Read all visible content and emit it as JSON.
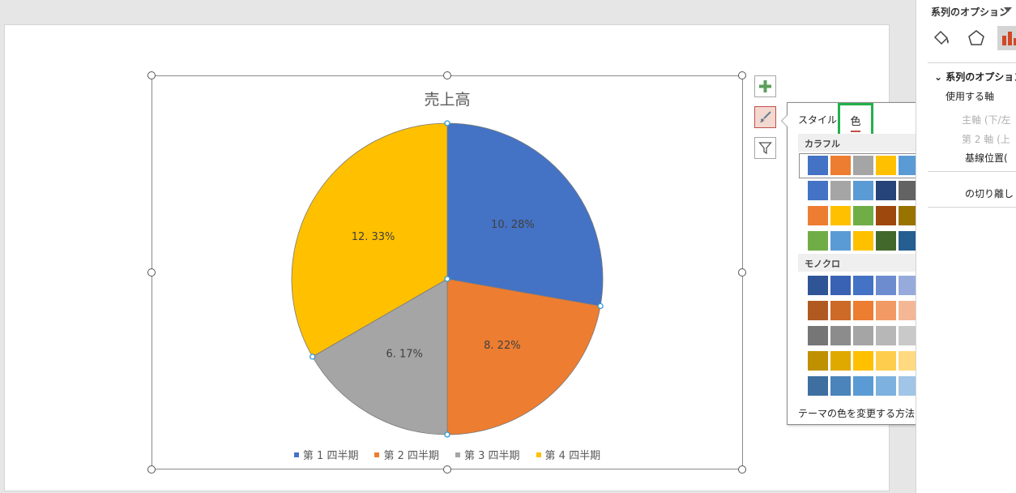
{
  "chart_data": {
    "type": "pie",
    "title": "売上高",
    "categories": [
      "第 1 四半期",
      "第 2 四半期",
      "第 3 四半期",
      "第 4 四半期"
    ],
    "values": [
      10.28,
      8.22,
      6.17,
      12.33
    ],
    "labels": [
      "10. 28%",
      "8. 22%",
      "6. 17%",
      "12. 33%"
    ],
    "colors": [
      "#4472c4",
      "#ed7d31",
      "#a5a5a5",
      "#ffc000"
    ],
    "legend": "bottom"
  },
  "chart_tools": {
    "elements_icon": "plus-icon",
    "styles_icon": "paintbrush-icon",
    "filters_icon": "funnel-icon"
  },
  "style_popup": {
    "tab_style": "スタイル",
    "tab_color": "色",
    "section_colorful": "カラフル",
    "section_mono": "モノクロ",
    "colorful_rows": [
      [
        "#4472c4",
        "#ed7d31",
        "#a5a5a5",
        "#ffc000",
        "#5b9bd5",
        "#70ad47"
      ],
      [
        "#4472c4",
        "#a5a5a5",
        "#5b9bd5",
        "#264478",
        "#636363",
        "#255e91"
      ],
      [
        "#ed7d31",
        "#ffc000",
        "#70ad47",
        "#9e480e",
        "#997300",
        "#43682b"
      ],
      [
        "#70ad47",
        "#5b9bd5",
        "#ffc000",
        "#43682b",
        "#255e91",
        "#997300"
      ]
    ],
    "mono_rows": [
      [
        "#2f5597",
        "#3a62b4",
        "#4472c4",
        "#6d8cd0",
        "#96abdc",
        "#c0cbe8"
      ],
      [
        "#b05a22",
        "#cd6a28",
        "#ed7d31",
        "#f19a63",
        "#f4b796",
        "#f8d5c4"
      ],
      [
        "#767676",
        "#8c8c8c",
        "#a5a5a5",
        "#b7b7b7",
        "#c9c9c9",
        "#dbdbdb"
      ],
      [
        "#bf9000",
        "#e0a900",
        "#ffc000",
        "#ffcd4d",
        "#ffda80",
        "#ffe7b3"
      ],
      [
        "#3e6fa0",
        "#4a84bb",
        "#5b9bd5",
        "#7db1de",
        "#a0c5e7",
        "#c4daf1"
      ]
    ],
    "link": "テーマの色を変更する方法"
  },
  "format_pane": {
    "title": "系列のオプション",
    "icons": [
      "fill-line-icon",
      "effects-icon",
      "series-options-icon"
    ],
    "section": "系列のオプション",
    "axis_label": "使用する軸",
    "primary_axis": "主軸 (下/左",
    "secondary_axis": "第 2 軸 (上",
    "angle_label": "基線位置(",
    "explosion_label": "の切り離し"
  }
}
